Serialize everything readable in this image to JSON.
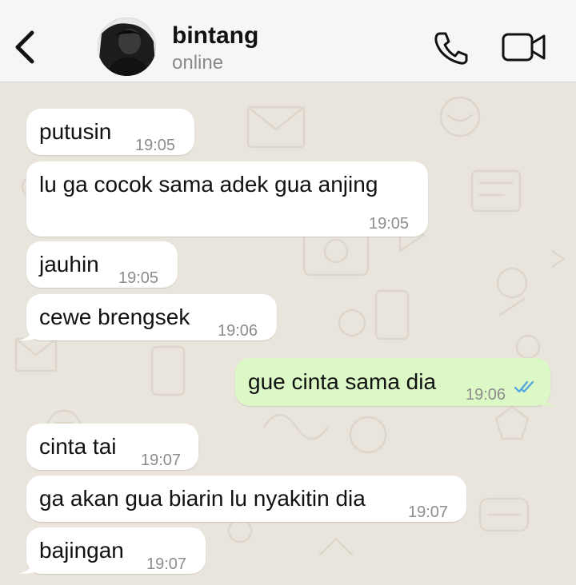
{
  "header": {
    "contact_name": "bintang",
    "status": "online",
    "back_icon": "chevron-left-icon",
    "call_icon": "phone-icon",
    "video_icon": "video-camera-icon"
  },
  "messages": [
    {
      "direction": "in",
      "text": "putusin",
      "time": "19:05"
    },
    {
      "direction": "in",
      "text": "lu ga cocok sama adek gua anjing",
      "time": "19:05"
    },
    {
      "direction": "in",
      "text": "jauhin",
      "time": "19:05"
    },
    {
      "direction": "in",
      "text": "cewe brengsek",
      "time": "19:06"
    },
    {
      "direction": "out",
      "text": "gue cinta sama dia",
      "time": "19:06",
      "status": "read",
      "status_icon": "double-check-icon"
    },
    {
      "direction": "in",
      "text": "cinta tai",
      "time": "19:07"
    },
    {
      "direction": "in",
      "text": "ga akan gua biarin lu nyakitin dia",
      "time": "19:07"
    },
    {
      "direction": "in",
      "text": "bajingan",
      "time": "19:07"
    }
  ],
  "colors": {
    "incoming_bubble": "#ffffff",
    "outgoing_bubble": "#dcf8c6",
    "chat_background": "#e9e4dc",
    "read_ticks": "#4fa3e0"
  }
}
